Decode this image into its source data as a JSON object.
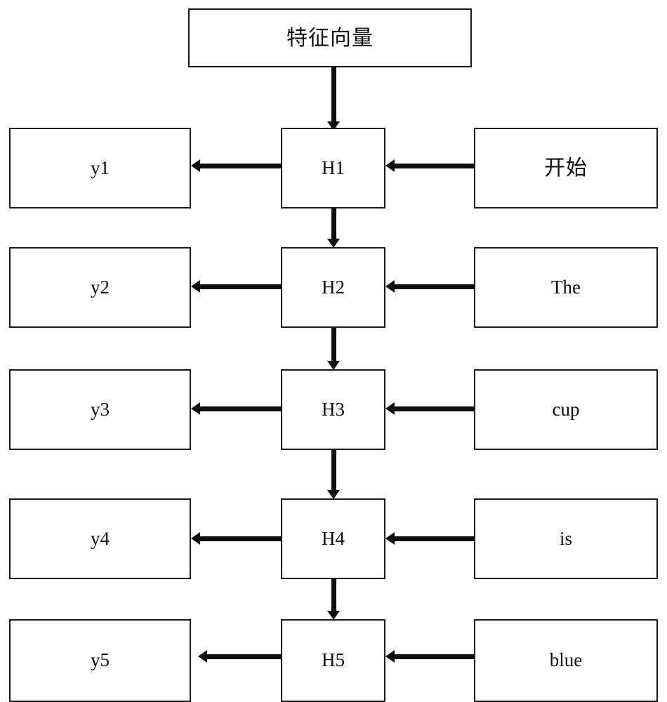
{
  "diagram": {
    "title": "特征向量",
    "feature_box": {
      "label": "特征向量",
      "script": "cjk"
    },
    "rows": [
      {
        "hidden_label": "H1",
        "output_label": "y1",
        "input_label": "开始",
        "input_script": "cjk"
      },
      {
        "hidden_label": "H2",
        "output_label": "y2",
        "input_label": "The",
        "input_script": "latin"
      },
      {
        "hidden_label": "H3",
        "output_label": "y3",
        "input_label": "cup",
        "input_script": "latin"
      },
      {
        "hidden_label": "H4",
        "output_label": "y4",
        "input_label": "is",
        "input_script": "latin"
      },
      {
        "hidden_label": "H5",
        "output_label": "y5",
        "input_label": "blue",
        "input_script": "latin"
      }
    ],
    "colors": {
      "stroke": "#1a1a1a",
      "arrow": "#0d0d0d",
      "background": "#ffffff",
      "text": "#0d0d0d"
    }
  }
}
